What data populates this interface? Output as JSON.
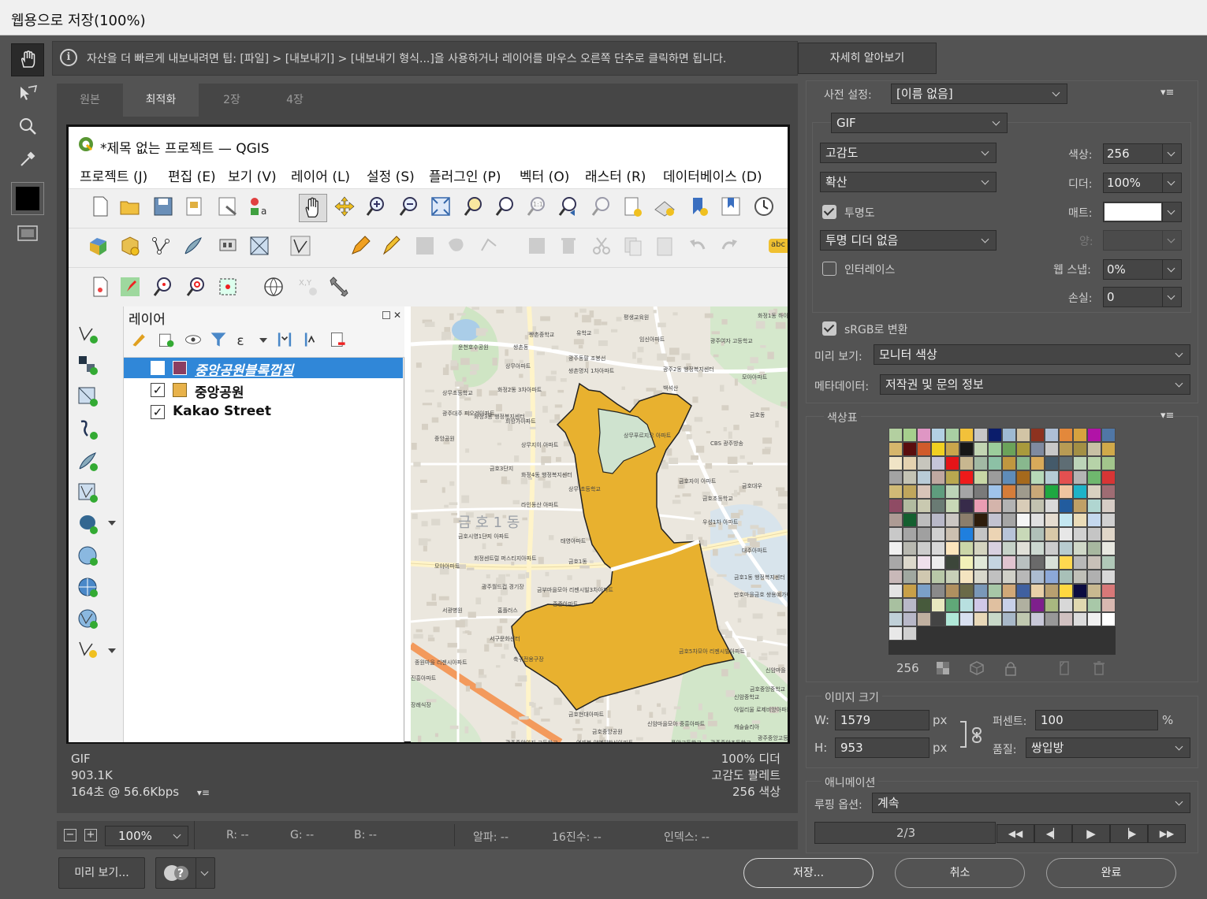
{
  "window": {
    "title": "웹용으로 저장(100%)"
  },
  "tip": {
    "text": "자산을 더 빠르게 내보내려면 팁: [파일] > [내보내기] > [내보내기 형식...]을 사용하거나 레이어를 마우스 오른쪽 단추로 클릭하면 됩니다.",
    "learn_more": "자세히 알아보기"
  },
  "tabs": [
    "원본",
    "최적화",
    "2장",
    "4장"
  ],
  "active_tab": "최적화",
  "qgis": {
    "title": "*제목 없는 프로젝트 — QGIS",
    "menu": [
      "프로젝트 (J)",
      "편집 (E)",
      "보기 (V)",
      "레이어 (L)",
      "설정 (S)",
      "플러그인 (P)",
      "벡터 (O)",
      "래스터 (R)",
      "데이터베이스 (D)"
    ],
    "layers_title": "레이어",
    "layers": [
      {
        "name": "중앙공원블록껍질",
        "checked": false,
        "selected": true
      },
      {
        "name": "중앙공원",
        "checked": true,
        "selected": false
      },
      {
        "name": "Kakao Street",
        "checked": true,
        "selected": false
      }
    ],
    "map_labels": [
      "평생교육원",
      "화정1동 하이용패쇼이에트",
      "쌍촌중학교",
      "유학교",
      "임신아파트",
      "광주여자 고등학교",
      "운천호수공원",
      "쌍촌동",
      "광주동팔 조봉선",
      "상무아파트",
      "쌍촌명지 1차아파트",
      "광주2동 행정복지센터",
      "모아아파트",
      "화정2동 3차아파트",
      "상무초등학교",
      "백석산",
      "금호동",
      "광주대주 피오레아파트",
      "화정3동 행정복지센터",
      "희망가아파트",
      "상무푸르지오 아파트",
      "상무지이 아파트",
      "CBS 광주방송",
      "중앙공원",
      "금호3단지",
      "화정4동 행정복지센터",
      "상무 초등학교",
      "금호자이 아파트",
      "금호초등학교",
      "라인동산 아파트",
      "금호대우",
      "우성1차 아파트",
      "금호시영1단지 아파트",
      "태영아파트",
      "대주아파트",
      "회정센트럴 퍼스티지아파트",
      "금호1동",
      "모아아파트",
      "광주월드컵 경기장",
      "금호1동 행정복지센터",
      "금부마을모아 리젠시빌3차아파트",
      "만호마을금호 쌍용예가아파트",
      "서광병원",
      "홈플러스",
      "종중아파트",
      "서구문화센터",
      "축구전용구장",
      "종원마을 리젠시아파트",
      "금호5차모아 리젠시빌아파트",
      "금호중앙중학교",
      "진흥아파트",
      "금호현대아파트",
      "아일리울 로제비앙아파트",
      "금호중앙공원",
      "캐슬솔리아",
      "신암마을모아 중흥아파트",
      "광주중앙고등학교",
      "장례식장",
      "연재봉 양병원",
      "광주중앙초등학교",
      "한신아파트",
      "광주중앙여자 고등학교",
      "풍암고등학교",
      "신암중학교",
      "신암마을"
    ],
    "map_district": "금 호 1 동"
  },
  "preview_status": {
    "left": [
      "GIF",
      "903.1K",
      "164초 @ 56.6Kbps"
    ],
    "right": [
      "100% 디더",
      "고감도 팔레트",
      "256 색상"
    ]
  },
  "bottom_status": {
    "zoom": "100%",
    "r": "R: --",
    "g": "G: --",
    "b": "B: --",
    "alpha": "알파: --",
    "hex": "16진수: --",
    "index": "인덱스: --"
  },
  "buttons": {
    "preview": "미리 보기...",
    "save": "저장...",
    "cancel": "취소",
    "done": "완료"
  },
  "settings": {
    "preset_label": "사전 설정:",
    "preset_value": "[이름 없음]",
    "format": "GIF",
    "reduction": "고감도",
    "colors_label": "색상:",
    "colors_value": "256",
    "dither_algo": "확산",
    "dither_label": "디더:",
    "dither_value": "100%",
    "transparency_label": "투명도",
    "transparency_checked": true,
    "matte_label": "매트:",
    "matte_color": "#ffffff",
    "trans_dither": "투명 디더 없음",
    "amount_label": "양:",
    "amount_value": "",
    "interlaced_label": "인터레이스",
    "interlaced_checked": false,
    "websnap_label": "웹 스냅:",
    "websnap_value": "0%",
    "lossy_label": "손실:",
    "lossy_value": "0",
    "srgb_label": "sRGB로 변환",
    "srgb_checked": true,
    "preview_label": "미리 보기:",
    "preview_value": "모니터 색상",
    "metadata_label": "메타데이터:",
    "metadata_value": "저작권 및 문의 정보"
  },
  "color_table": {
    "title": "색상표",
    "count": "256",
    "colors": [
      "#b3cfa0",
      "#a6cf8d",
      "#df96c4",
      "#b3d0e3",
      "#a9cfa3",
      "#f2c13a",
      "#c6c6c6",
      "#0b1d6b",
      "#9fbad2",
      "#d2c4a5",
      "#8d321f",
      "#aebfd6",
      "#e3883b",
      "#d6a23f",
      "#b113a7",
      "#5077a6",
      "#d6b66c",
      "#5a0e0e",
      "#d05b2b",
      "#f0d021",
      "#c9a64c",
      "#171717",
      "#c2d5b3",
      "#9bcd9b",
      "#6ba35a",
      "#a99a3c",
      "#7f8aa0",
      "#c8c8c8",
      "#b89b54",
      "#a38f44",
      "#c8c0a4",
      "#d0a94a",
      "#f0e4c6",
      "#e4d2b0",
      "#c7c6bd",
      "#c5c5d9",
      "#e51418",
      "#c8b790",
      "#a2b9a4",
      "#8cc1a5",
      "#c09740",
      "#88b88e",
      "#d8aa5a",
      "#445a6a",
      "#5e6d74",
      "#bcd4b9",
      "#b6d2a8",
      "#a2c58c",
      "#a3a3a3",
      "#c4c3b4",
      "#b9cbd7",
      "#c0a8a0",
      "#b9a84f",
      "#ee1a1a",
      "#c8d7a6",
      "#9c9c9c",
      "#5f8cb8",
      "#a5691c",
      "#b7d9b8",
      "#b6ccd5",
      "#e35050",
      "#b4b4b4",
      "#6fb76e",
      "#d73535",
      "#d0ba76",
      "#c0a65c",
      "#d8c4b8",
      "#5f9d7e",
      "#bcd4b8",
      "#a5a5a5",
      "#7a7a7a",
      "#9fc3ea",
      "#d57d3a",
      "#9f9b8d",
      "#c9a878",
      "#1fa841",
      "#efc4a0",
      "#1eb3c8",
      "#d8d0c0",
      "#9f6c73",
      "#8f4b64",
      "#b2bba0",
      "#c9c9b0",
      "#6a7b74",
      "#c8d8b6",
      "#372b4a",
      "#e99db3",
      "#d4b4ab",
      "#b3b3b3",
      "#d8ccb8",
      "#c2c2b0",
      "#d9d9d9",
      "#225c9e",
      "#c0a066",
      "#b0d6d1",
      "#d6ccc5",
      "#ad9b94",
      "#145f2f",
      "#bdbdbd",
      "#b8b8c8",
      "#cbc7c3",
      "#8c7e6c",
      "#2e1c0b",
      "#c2c2d0",
      "#a5a5a5",
      "#f5f5f5",
      "#e0e0e0",
      "#e5dcd0",
      "#c4e7f1",
      "#eadcb8",
      "#c4d8ee",
      "#d0d0d0",
      "#c8c8c8",
      "#a5a5a5",
      "#a0a0a0",
      "#d0d0d0",
      "#ccc0b0",
      "#1f7fde",
      "#c5c5c5",
      "#ecd4b4",
      "#b8c4d8",
      "#c8d8b8",
      "#b0c0b8",
      "#d8c8a8",
      "#e7e7e7",
      "#d1d1d1",
      "#c5c5c5",
      "#e0d6c8",
      "#f0f0f0",
      "#b8b8b0",
      "#cccccc",
      "#d8d8d8",
      "#fce5bc",
      "#cbd6a8",
      "#d4d4c0",
      "#d8d0e0",
      "#c6d2c8",
      "#e0e0d8",
      "#ccd8d0",
      "#cccccc",
      "#b8ccd0",
      "#d0d8c8",
      "#a8b8a0",
      "#e8e8e0",
      "#a8a8a8",
      "#dcd8cc",
      "#efe0ec",
      "#ededed",
      "#3c463a",
      "#f1f1b8",
      "#e0e8d8",
      "#c4d4e0",
      "#e0c4d0",
      "#b8c0c0",
      "#6a6a6a",
      "#d8e0d8",
      "#ffd850",
      "#b8b8b8",
      "#c8c0b8",
      "#b0c8b8",
      "#c8b8b8",
      "#a0a8a0",
      "#d0c8b0",
      "#b8c8a8",
      "#c8d0b8",
      "#f4e4c0",
      "#d8d8cc",
      "#c0c0c0",
      "#d0d0c8",
      "#b8b8b8",
      "#acbcd0",
      "#8ca8d8",
      "#a8c0b8",
      "#c0c0b8",
      "#b0b0b0",
      "#d8d8d8",
      "#e4e4e4",
      "#c8a048",
      "#7ba0c8",
      "#8a8a8a",
      "#b09060",
      "#6a6a48",
      "#7a98b8",
      "#a7c7a7",
      "#d0a878",
      "#4060a0",
      "#e8d0a8",
      "#b8a070",
      "#ffd840",
      "#0c0c40",
      "#c8b890",
      "#d87878",
      "#a8c0a0",
      "#b8b8c8",
      "#475a3c",
      "#e8e8c0",
      "#60a878",
      "#b8e0e0",
      "#d0c8e8",
      "#e0c0a0",
      "#c8d0e8",
      "#b0b0a0",
      "#7e1f8c",
      "#a8b880",
      "#d8d8d8",
      "#e0d8b0",
      "#a8c8a8",
      "#d8b8b0",
      "#c0d0d8",
      "#b8b8c8",
      "#c0b0a0",
      "#444444",
      "#b0e8d8",
      "#d8e0f0",
      "#e8d8b8",
      "#c8d8c8",
      "#a8b8c8",
      "#c0c8b0",
      "#c8c8d8",
      "#989898",
      "#d0c0c0",
      "#dcdcdc",
      "#f0f0f0",
      "#ffffff",
      "#e8e8e8",
      "#d0d0d0"
    ]
  },
  "image_size": {
    "title": "이미지 크기",
    "w_label": "W:",
    "w_value": "1579",
    "w_unit": "px",
    "h_label": "H:",
    "h_value": "953",
    "h_unit": "px",
    "percent_label": "퍼센트:",
    "percent_value": "100",
    "percent_unit": "%",
    "quality_label": "품질:",
    "quality_value": "쌍입방"
  },
  "animation": {
    "title": "애니메이션",
    "loop_label": "루핑 옵션:",
    "loop_value": "계속",
    "frame": "2/3"
  }
}
